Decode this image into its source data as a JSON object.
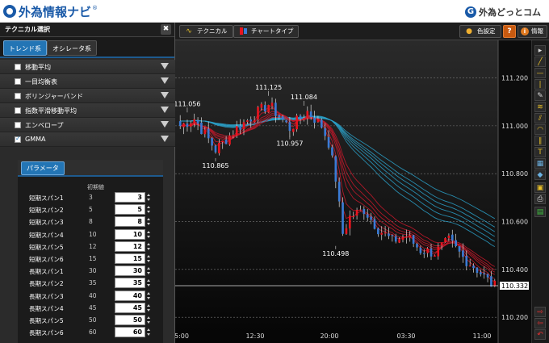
{
  "header": {
    "logo_text": "外為情報ナビ",
    "logo_mark": "®",
    "partner_text": "外為どっとコム",
    "partner_icon": "G"
  },
  "left_panel": {
    "title": "テクニカル選択",
    "close_icon": "✖",
    "tabs": [
      {
        "label": "トレンド系",
        "active": true
      },
      {
        "label": "オシレータ系",
        "active": false
      }
    ],
    "indicators": [
      {
        "label": "移動平均",
        "checked": false
      },
      {
        "label": "一目均衡表",
        "checked": false
      },
      {
        "label": "ボリンジャーバンド",
        "checked": false
      },
      {
        "label": "指数平滑移動平均",
        "checked": false
      },
      {
        "label": "エンベロープ",
        "checked": false
      },
      {
        "label": "GMMA",
        "checked": true
      }
    ],
    "params": {
      "tab_label": "パラメータ",
      "default_header": "初期値",
      "rows": [
        {
          "label": "短期スパン1",
          "default": "3",
          "value": "3"
        },
        {
          "label": "短期スパン2",
          "default": "5",
          "value": "5"
        },
        {
          "label": "短期スパン3",
          "default": "8",
          "value": "8"
        },
        {
          "label": "短期スパン4",
          "default": "10",
          "value": "10"
        },
        {
          "label": "短期スパン5",
          "default": "12",
          "value": "12"
        },
        {
          "label": "短期スパン6",
          "default": "15",
          "value": "15"
        },
        {
          "label": "長期スパン1",
          "default": "30",
          "value": "30"
        },
        {
          "label": "長期スパン2",
          "default": "35",
          "value": "35"
        },
        {
          "label": "長期スパン3",
          "default": "40",
          "value": "40"
        },
        {
          "label": "長期スパン4",
          "default": "45",
          "value": "45"
        },
        {
          "label": "長期スパン5",
          "default": "50",
          "value": "50"
        },
        {
          "label": "長期スパン6",
          "default": "60",
          "value": "60"
        }
      ]
    }
  },
  "toolbar": {
    "technical_label": "テクニカル",
    "technical_icon": "wave-icon",
    "charttype_label": "チャートタイプ",
    "charttype_icon": "candle-icon",
    "color_label": "色設定",
    "help_label": "?",
    "info_label": "情報",
    "info_icon": "i"
  },
  "colors": {
    "bull": "#e8141e",
    "bear": "#3a7bd5",
    "short_ma": "#c0182a",
    "long_ma": "#2aa0c8"
  },
  "chart_data": {
    "type": "candlestick",
    "y_ticks": [
      "111.200",
      "111.000",
      "110.800",
      "110.600",
      "110.400",
      "110.200"
    ],
    "x_ticks": [
      "5:00",
      "12:30",
      "20:00",
      "03:30",
      "11:00"
    ],
    "current_price": "110.332",
    "ylim": [
      110.15,
      111.33
    ],
    "annotations": [
      {
        "label": "111.056",
        "x": 2,
        "price": 111.056
      },
      {
        "label": "111.125",
        "x": 25,
        "price": 111.125
      },
      {
        "label": "111.084",
        "x": 35,
        "price": 111.084
      },
      {
        "label": "110.865",
        "x": 10,
        "price": 110.865
      },
      {
        "label": "110.957",
        "x": 31,
        "price": 110.957
      },
      {
        "label": "110.498",
        "x": 44,
        "price": 110.498
      }
    ]
  }
}
